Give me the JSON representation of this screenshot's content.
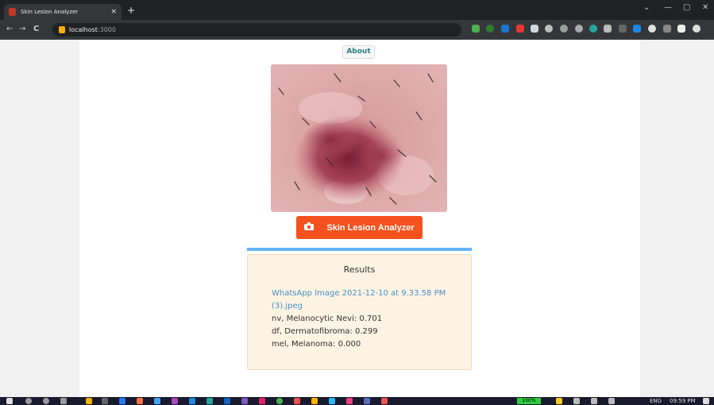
{
  "browser": {
    "tab_title": "Skin Lesion Analyzer",
    "tab_close": "×",
    "new_tab": "+",
    "url_host": "localhost",
    "url_port": ":3000",
    "back": "←",
    "forward": "→",
    "reload": "C",
    "win_minimize": "—",
    "win_maximize": "▢",
    "win_close": "✕",
    "win_chevron": "⌄"
  },
  "page": {
    "about_label": "About",
    "analyze_label": "Skin Lesion Analyzer",
    "progress_fraction": 1.0,
    "results": {
      "heading": "Results",
      "file_name": "WhatsApp Image 2021-12-10 at 9.33.58 PM (3).jpeg",
      "predictions": [
        "nv, Melanocytic Nevi: 0.701",
        "df, Dermatofibroma: 0.299",
        "mel, Melanoma: 0.000"
      ]
    }
  },
  "taskbar": {
    "battery": "100%",
    "language": "ENG",
    "time": "09:59 PM"
  },
  "colors": {
    "accent": "#f4511e",
    "progress": "#64b5f6",
    "results_bg": "#fdf3e3",
    "link": "#4a90c4"
  }
}
